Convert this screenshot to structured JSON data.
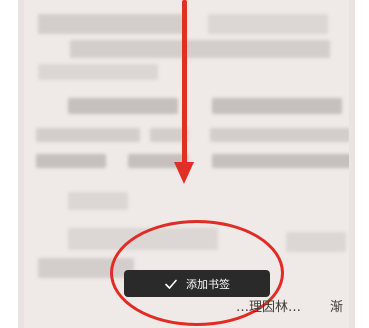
{
  "toast": {
    "label": "添加书签"
  },
  "content": {
    "body_line": "…理因林…",
    "trailing_char": "渐"
  },
  "annotations": {
    "highlight_color": "#e12c25",
    "arrow_color": "#e22f26"
  }
}
